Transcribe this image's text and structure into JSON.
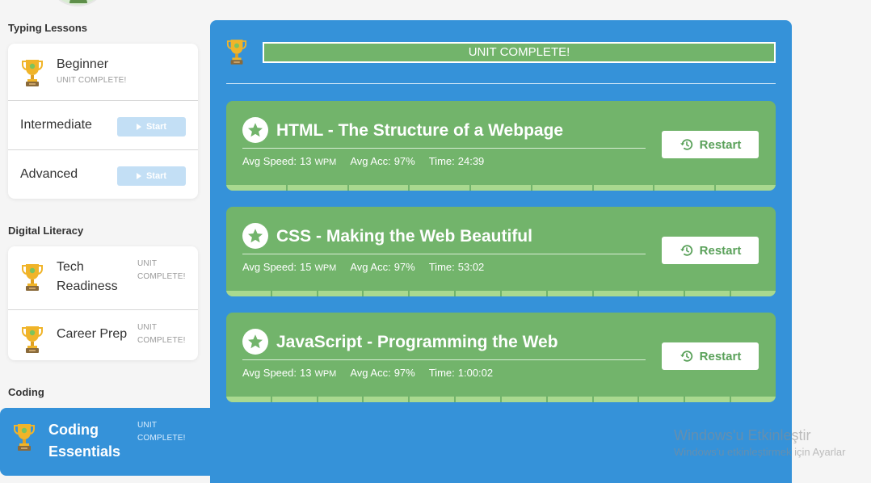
{
  "sidebar": {
    "sections": [
      {
        "title": "Typing Lessons",
        "items": [
          {
            "label": "Beginner",
            "status": "UNIT COMPLETE!"
          },
          {
            "label": "Intermediate",
            "button": "Start"
          },
          {
            "label": "Advanced",
            "button": "Start"
          }
        ]
      },
      {
        "title": "Digital Literacy",
        "items": [
          {
            "label_line1": "Tech",
            "label_line2": "Readiness",
            "status_line1": "UNIT",
            "status_line2": "COMPLETE!"
          },
          {
            "label": "Career Prep",
            "status_line1": "UNIT",
            "status_line2": "COMPLETE!"
          }
        ]
      },
      {
        "title": "Coding",
        "items": [
          {
            "label_line1": "Coding",
            "label_line2": "Essentials",
            "status_line1": "UNIT",
            "status_line2": "COMPLETE!"
          }
        ]
      }
    ]
  },
  "main": {
    "banner": "UNIT COMPLETE!",
    "lessons": [
      {
        "title": "HTML - The Structure of a Webpage",
        "speed_label": "Avg Speed:",
        "speed_value": "13",
        "speed_unit": "WPM",
        "acc_label": "Avg Acc:",
        "acc_value": "97%",
        "time_label": "Time:",
        "time_value": "24:39",
        "button": "Restart",
        "segments": 9
      },
      {
        "title": "CSS - Making the Web Beautiful",
        "speed_label": "Avg Speed:",
        "speed_value": "15",
        "speed_unit": "WPM",
        "acc_label": "Avg Acc:",
        "acc_value": "97%",
        "time_label": "Time:",
        "time_value": "53:02",
        "button": "Restart",
        "segments": 12
      },
      {
        "title": "JavaScript - Programming the Web",
        "speed_label": "Avg Speed:",
        "speed_value": "13",
        "speed_unit": "WPM",
        "acc_label": "Avg Acc:",
        "acc_value": "97%",
        "time_label": "Time:",
        "time_value": "1:00:02",
        "button": "Restart",
        "segments": 12
      }
    ]
  },
  "watermark": {
    "line1": "Windows'u Etkinleştir",
    "line2": "Windows'u etkinleştirmek için Ayarlar"
  },
  "colors": {
    "accent_blue": "#3592d9",
    "lesson_green": "#72b46b",
    "progress_green": "#a9d98f",
    "start_disabled": "#c3dff5",
    "trophy_gold": "#f0b429"
  }
}
